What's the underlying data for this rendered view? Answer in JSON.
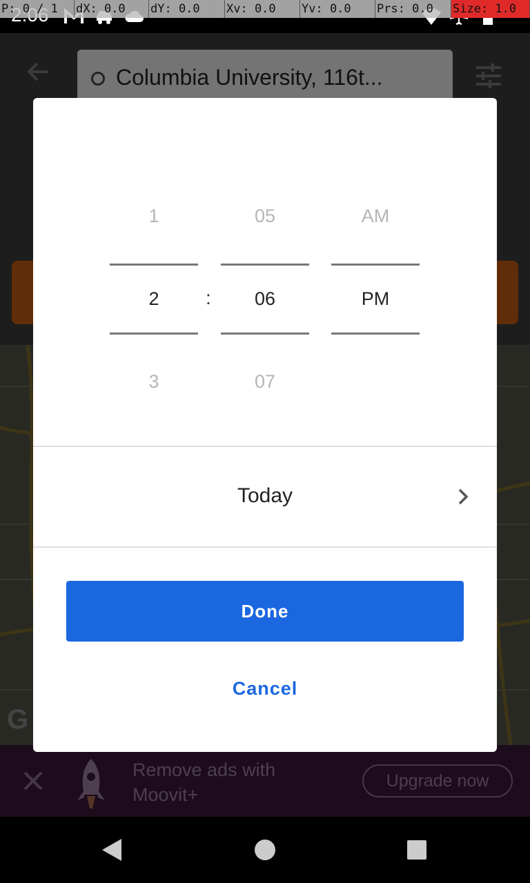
{
  "status_bar": {
    "time": "2:06",
    "debug": [
      {
        "label": "P: 0 / 1"
      },
      {
        "label": "dX: 0.0"
      },
      {
        "label": "dY: 0.0"
      },
      {
        "label": "Xv: 0.0"
      },
      {
        "label": "Yv: 0.0"
      },
      {
        "label": "Prs: 0.0"
      },
      {
        "label": "Size: 1.0"
      }
    ]
  },
  "header": {
    "origin_text": "Columbia University, 116t..."
  },
  "ad": {
    "text_line1": "Remove ads with",
    "text_line2": "Moovit+",
    "upgrade_label": "Upgrade now"
  },
  "time_picker": {
    "hour": {
      "prev": "1",
      "selected": "2",
      "next": "3"
    },
    "separator": ":",
    "minute": {
      "prev": "05",
      "selected": "06",
      "next": "07"
    },
    "meridiem": {
      "prev": "AM",
      "selected": "PM"
    }
  },
  "date_row": {
    "label": "Today"
  },
  "actions": {
    "done_label": "Done",
    "cancel_label": "Cancel"
  },
  "colors": {
    "accent": "#1b67e0",
    "dialog_bg": "#ffffff",
    "ad_bg": "#3a1a38"
  }
}
